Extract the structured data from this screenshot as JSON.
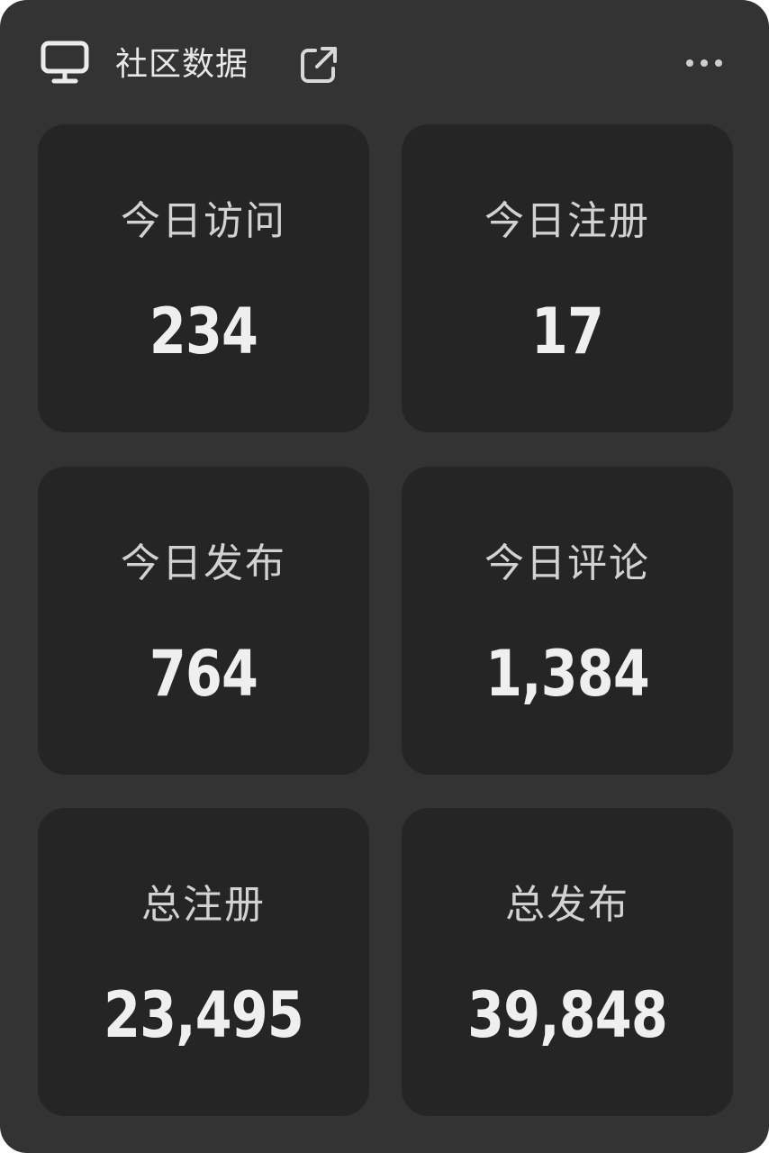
{
  "widget": {
    "title": "社区数据",
    "icons": {
      "leading": "monitor-icon",
      "title_action": "external-link-icon",
      "menu": "more-horizontal-icon"
    }
  },
  "stats": [
    {
      "label": "今日访问",
      "value": "234"
    },
    {
      "label": "今日注册",
      "value": "17"
    },
    {
      "label": "今日发布",
      "value": "764"
    },
    {
      "label": "今日评论",
      "value": "1,384"
    },
    {
      "label": "总注册",
      "value": "23,495"
    },
    {
      "label": "总发布",
      "value": "39,848"
    }
  ],
  "colors": {
    "panel": "#333333",
    "card": "#252525",
    "text": "#efefef",
    "muted_text": "#d2d2d2"
  }
}
